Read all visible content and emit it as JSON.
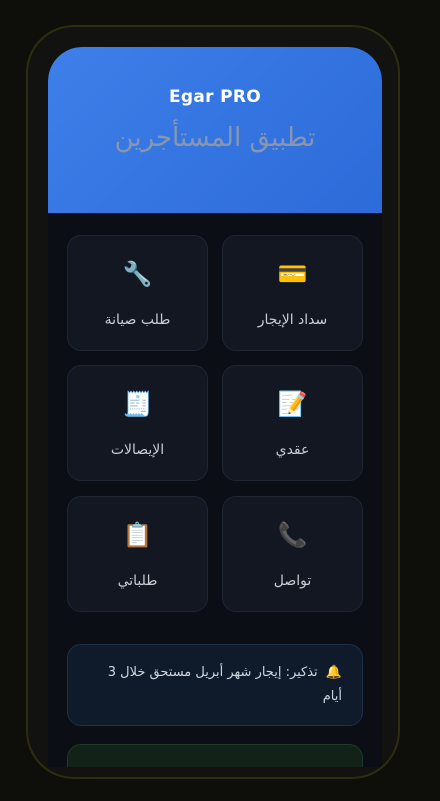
{
  "header": {
    "app_title": "Egar PRO",
    "app_subtitle": "تطبيق المستأجرين"
  },
  "tiles": [
    {
      "label": "سداد الإيجار",
      "icon": "💳",
      "icon_name": "credit-card-icon"
    },
    {
      "label": "طلب صيانة",
      "icon": "🔧",
      "icon_name": "wrench-icon"
    },
    {
      "label": "عقدي",
      "icon": "📝",
      "icon_name": "memo-icon"
    },
    {
      "label": "الإيصالات",
      "icon": "🧾",
      "icon_name": "receipt-icon"
    },
    {
      "label": "تواصل",
      "icon": "📞",
      "icon_name": "phone-icon"
    },
    {
      "label": "طلباتي",
      "icon": "📋",
      "icon_name": "clipboard-icon"
    }
  ],
  "reminder": {
    "icon": "🔔",
    "icon_name": "bell-icon",
    "text": "تذكير: إيجار شهر أبريل مستحق خلال 3 أيام"
  },
  "colors": {
    "header_gradient_start": "#3e7fe9",
    "header_gradient_end": "#2c6bd9",
    "tile_background": "#121722",
    "reminder_background": "#0f1a2a"
  }
}
